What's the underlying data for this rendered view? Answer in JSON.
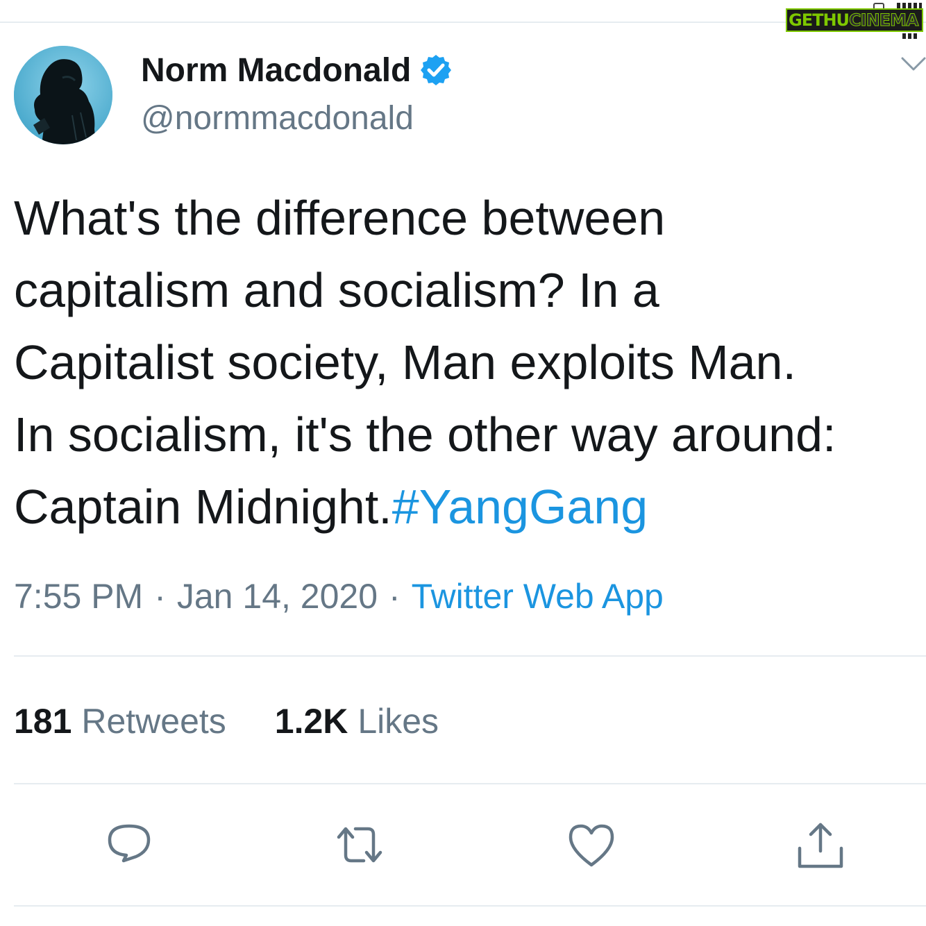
{
  "watermark": {
    "part1": "GETHU",
    "part2": "CINEMA"
  },
  "user": {
    "display_name": "Norm Macdonald",
    "handle": "@normmacdonald",
    "verified_icon": "verified-badge-icon",
    "verified_color": "#1da1f2"
  },
  "tweet": {
    "lines": [
      "What's the difference between",
      "capitalism and socialism? In a",
      "Capitalist society, Man exploits Man.",
      "In socialism, it's the other way around:"
    ],
    "last_line_text": "Captain Midnight.",
    "hashtag": "#YangGang"
  },
  "meta": {
    "time": "7:55 PM",
    "separator": "·",
    "date": "Jan 14, 2020",
    "source": "Twitter Web App"
  },
  "stats": {
    "retweets_count": "181",
    "retweets_label": "Retweets",
    "likes_count": "1.2K",
    "likes_label": "Likes"
  },
  "actions": [
    {
      "name": "reply",
      "icon": "reply-icon"
    },
    {
      "name": "retweet",
      "icon": "retweet-icon"
    },
    {
      "name": "like",
      "icon": "heart-icon"
    },
    {
      "name": "share",
      "icon": "share-icon"
    }
  ],
  "colors": {
    "text": "#14171a",
    "secondary": "#657786",
    "link": "#1b95e0",
    "divider": "#e6ecf0",
    "icon": "#657786"
  }
}
